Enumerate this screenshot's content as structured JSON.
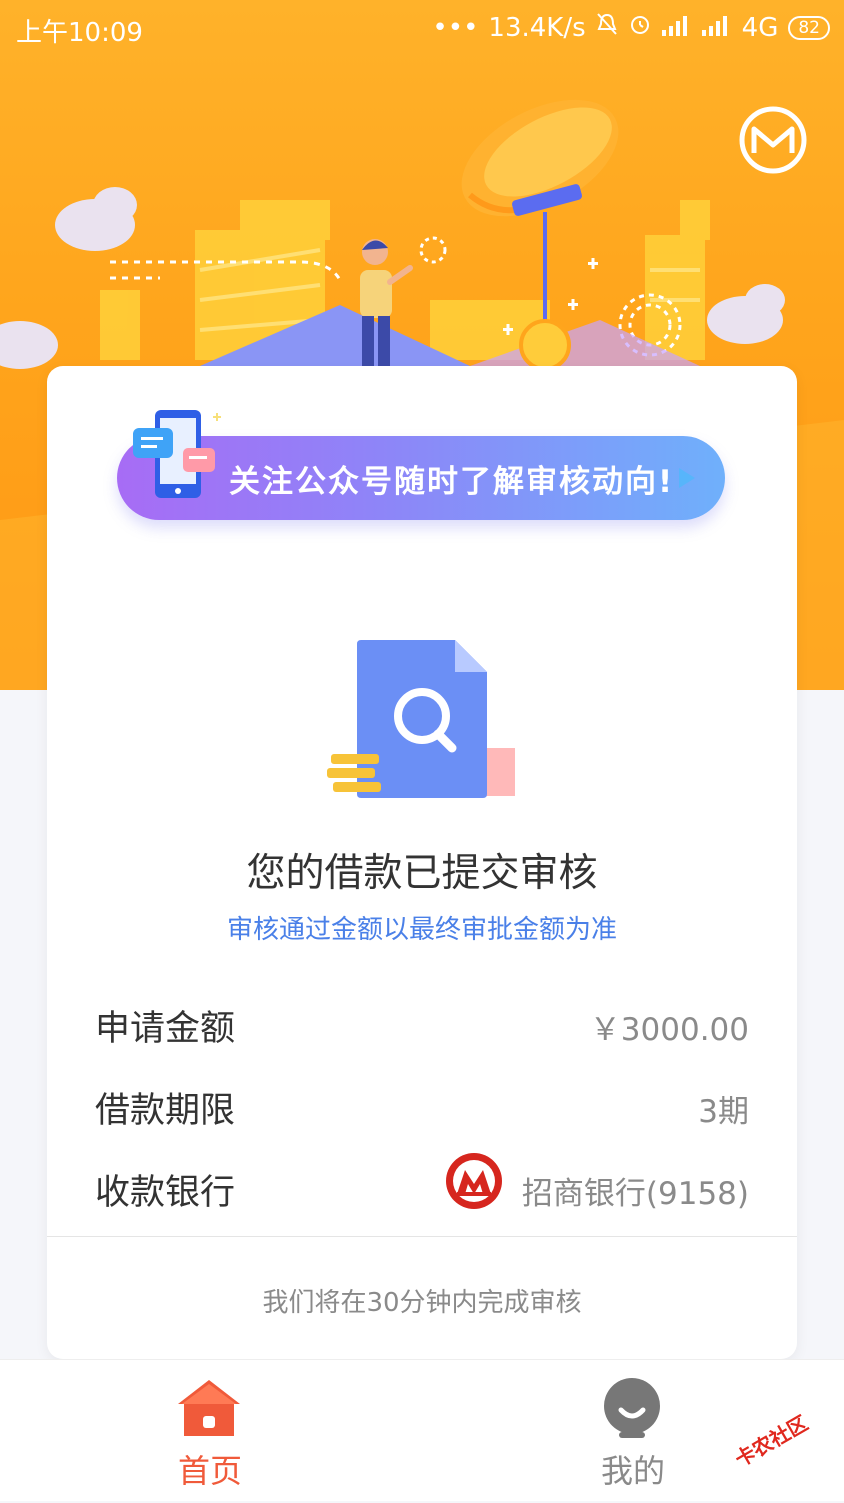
{
  "status_bar": {
    "time": "上午10:09",
    "network_speed": "13.4K/s",
    "network_type": "4G",
    "battery": "82"
  },
  "banner": {
    "text": "关注公众号随时了解审核动向!"
  },
  "review": {
    "title": "您的借款已提交审核",
    "subtitle": "审核通过金额以最终审批金额为准"
  },
  "details": [
    {
      "label": "申请金额",
      "value": "￥3000.00"
    },
    {
      "label": "借款期限",
      "value": "3期"
    },
    {
      "label": "收款银行",
      "value": "招商银行(9158)"
    }
  ],
  "footer_note": "我们将在30分钟内完成审核",
  "nav": {
    "home_label": "首页",
    "mine_label": "我的",
    "active": "home"
  },
  "watermark": "卡农社区",
  "colors": {
    "hero_orange": "#ffa51c",
    "accent_blue": "#4a80e8",
    "nav_active": "#f05a3a",
    "nav_inactive": "#8a8a8a",
    "bank_red": "#d6261e"
  },
  "icons": {
    "brand": "envelope-m-logo",
    "doc": "document-search-icon",
    "bank": "cmb-bank-logo",
    "home": "home-icon",
    "mine": "user-icon"
  }
}
